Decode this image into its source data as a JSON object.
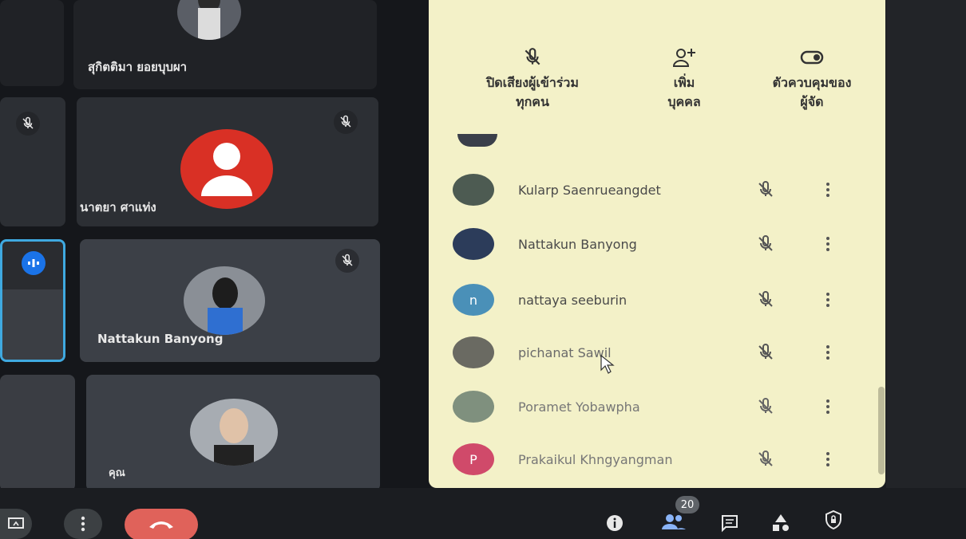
{
  "grid": {
    "tiles": [
      {
        "name": "สุกิตติมา ยอยบุบผา"
      },
      {
        "name": "นาตยา ศาแท่ง"
      },
      {
        "name": "Nattakun Banyong"
      },
      {
        "name": "คุณ"
      }
    ]
  },
  "panel": {
    "actions": [
      {
        "label_line1": "ปิดเสียงผู้เข้าร่วม",
        "label_line2": "ทุกคน",
        "icon": "mic-off-icon"
      },
      {
        "label_line1": "เพิ่ม",
        "label_line2": "บุคคล",
        "icon": "add-person-icon"
      },
      {
        "label_line1": "ตัวควบคุมของ",
        "label_line2": "ผู้จัด",
        "icon": "toggle-icon"
      }
    ],
    "participants": [
      {
        "name": "Kularp Saenrueangdet",
        "initial": ""
      },
      {
        "name": "Nattakun Banyong",
        "initial": ""
      },
      {
        "name": "nattaya seeburin",
        "initial": "n"
      },
      {
        "name": "pichanat Sawil",
        "initial": ""
      },
      {
        "name": "Poramet Yobawpha",
        "initial": ""
      },
      {
        "name": "Prakaikul Khngyangman",
        "initial": "P"
      }
    ]
  },
  "bottom": {
    "people_count": "20"
  },
  "colors": {
    "hangup": "#e0625a",
    "avatar_red": "#d93025",
    "avatar_n": "#4a90b8",
    "avatar_p": "#d04a6a",
    "active_border": "#3fa9e0"
  }
}
